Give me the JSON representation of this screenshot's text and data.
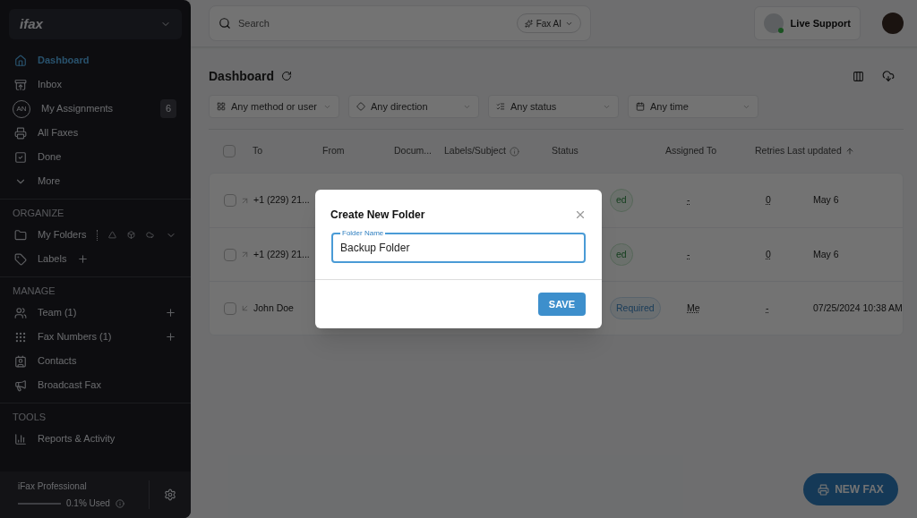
{
  "sidebar": {
    "logo": "ifax",
    "nav": [
      {
        "label": "Dashboard",
        "selected": true
      },
      {
        "label": "Inbox",
        "selected": false
      },
      {
        "label": "My Assignments",
        "initials": "AN",
        "count": "6",
        "selected": false
      },
      {
        "label": "All Faxes",
        "selected": false
      },
      {
        "label": "Done",
        "selected": false
      },
      {
        "label": "More",
        "selected": false
      }
    ],
    "sections": [
      {
        "title": "ORGANIZE",
        "items": [
          {
            "label": "My Folders",
            "kind": "folders",
            "selected": false
          },
          {
            "label": "Labels",
            "kind": "add-inline",
            "selected": false
          }
        ]
      },
      {
        "title": "MANAGE",
        "items": [
          {
            "label": "Team (1)",
            "kind": "add",
            "selected": false
          },
          {
            "label": "Fax Numbers (1)",
            "kind": "add",
            "selected": false
          },
          {
            "label": "Contacts",
            "kind": "plain",
            "selected": false
          },
          {
            "label": "Broadcast Fax",
            "kind": "plain",
            "selected": false
          }
        ]
      },
      {
        "title": "TOOLS",
        "items": [
          {
            "label": "Reports & Activity",
            "kind": "plain",
            "selected": false
          }
        ]
      }
    ],
    "plan": {
      "name": "iFax Professional",
      "usage": "0.1% Used",
      "level": 0.001
    }
  },
  "topbar": {
    "search": {
      "placeholder": "Search"
    },
    "ai_chip": "Fax AI",
    "support": "Live Support"
  },
  "page": {
    "title": "Dashboard",
    "filters": [
      "Any method or user",
      "Any direction",
      "Any status",
      "Any time"
    ],
    "table": {
      "select_all": {
        "checked": false
      },
      "columns": [
        "To",
        "From",
        "Docum...",
        "Labels/Subject",
        "Status",
        "Assigned To",
        "Retries",
        "Last updated"
      ],
      "rows": [
        {
          "checked": false,
          "kind": "outgoing",
          "to": "+1 (229) 21...",
          "status": {
            "text": "ed",
            "kind": "success"
          },
          "assigned": "-",
          "retries": "0",
          "updated": "May 6"
        },
        {
          "checked": false,
          "kind": "outgoing",
          "to": "+1 (229) 21...",
          "status": {
            "text": "ed",
            "kind": "success"
          },
          "assigned": "-",
          "retries": "0",
          "updated": "May 6"
        },
        {
          "checked": false,
          "kind": "incoming",
          "to": "John Doe",
          "status": {
            "text": "Required",
            "kind": "info"
          },
          "assigned": "Me",
          "retries": "-",
          "updated": "07/25/2024 10:38 AM"
        }
      ]
    },
    "new_fax": "NEW FAX"
  },
  "dialog": {
    "title": "Create New Folder",
    "field": {
      "label": "Folder Name",
      "value": "Backup Folder"
    },
    "save": "SAVE"
  }
}
